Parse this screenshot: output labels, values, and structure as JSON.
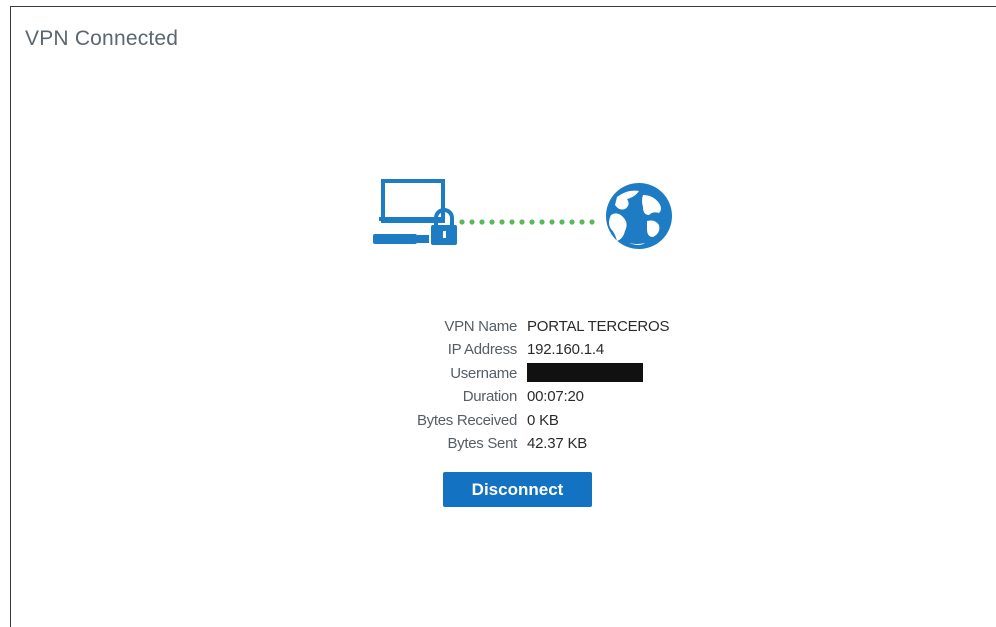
{
  "header": {
    "title": "VPN Connected"
  },
  "connection": {
    "rows": [
      {
        "label": "VPN Name",
        "value": "PORTAL TERCEROS"
      },
      {
        "label": "IP Address",
        "value": "192.160.1.4"
      },
      {
        "label": "Username",
        "value": "",
        "redacted": true
      },
      {
        "label": "Duration",
        "value": "00:07:20"
      },
      {
        "label": "Bytes Received",
        "value": "0 KB"
      },
      {
        "label": "Bytes Sent",
        "value": "42.37 KB"
      }
    ]
  },
  "actions": {
    "disconnect_label": "Disconnect"
  },
  "icons": {
    "computer": "computer-icon",
    "lock": "lock-icon",
    "globe": "globe-icon",
    "connection": "connection-dots"
  },
  "colors": {
    "accent": "#1372c1",
    "connection_dots": "#5cb85c",
    "icon_blue": "#1d7cc4"
  }
}
